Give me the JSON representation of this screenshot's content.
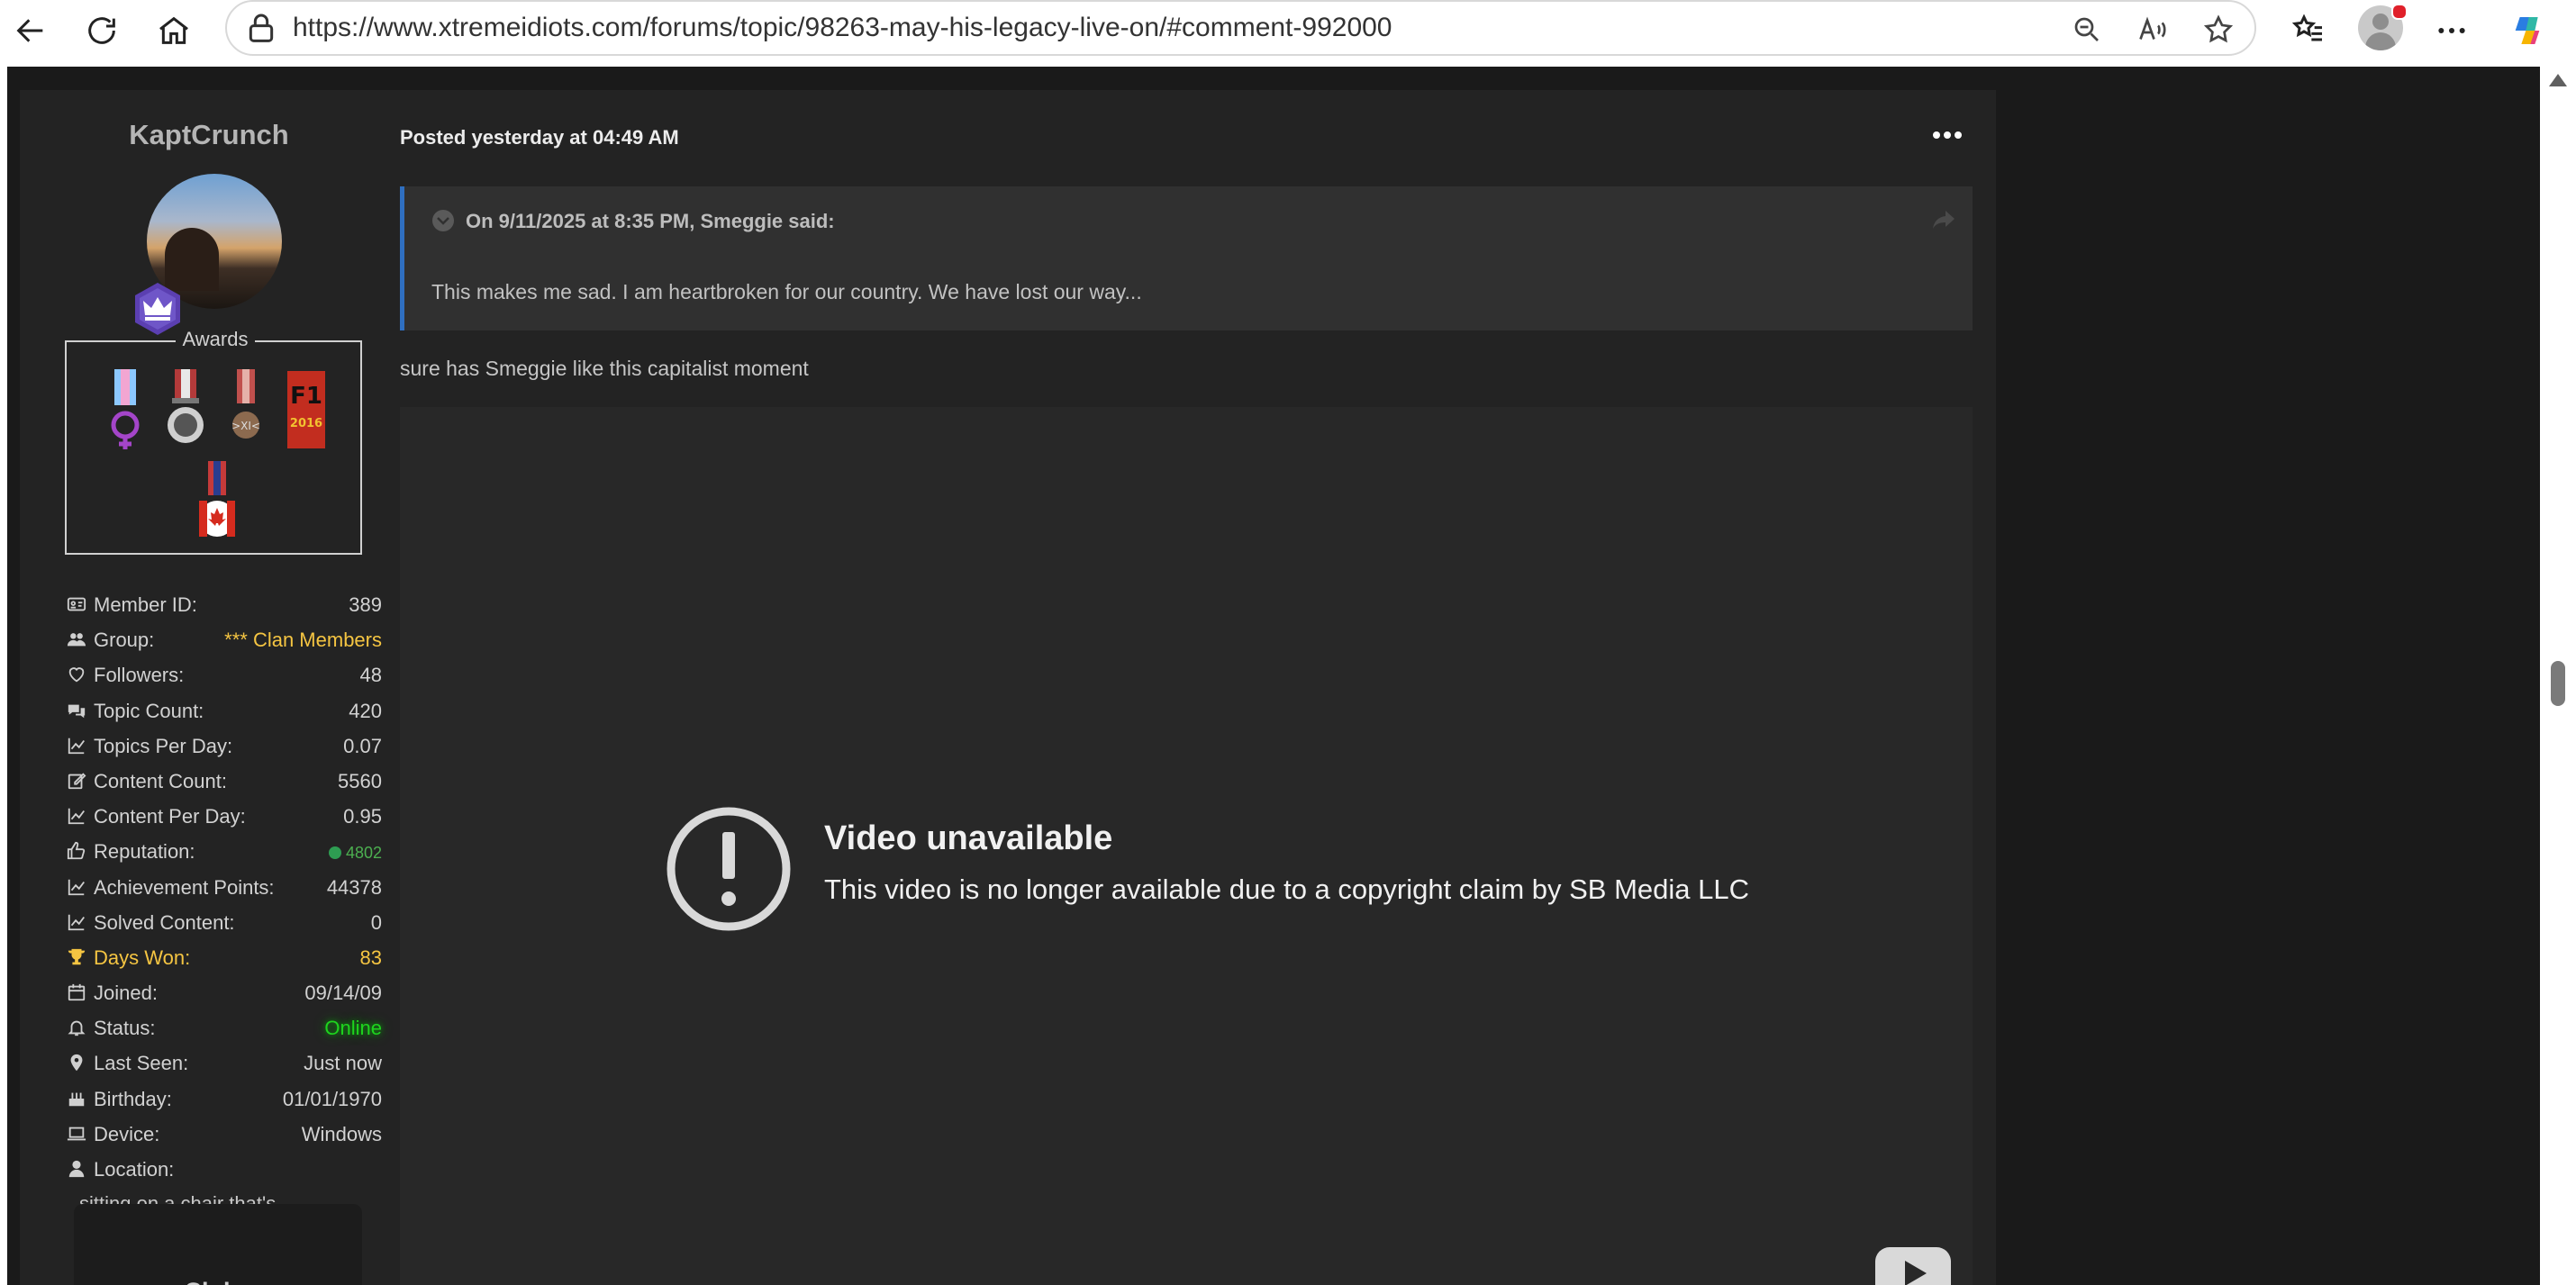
{
  "browser": {
    "url": "https://www.xtremeidiots.com/forums/topic/98263-may-his-legacy-live-on/#comment-992000"
  },
  "author": {
    "name": "KaptCrunch",
    "awards_title": "Awards",
    "stats": [
      {
        "icon": "id-card-icon",
        "label": "Member ID:",
        "value": "389"
      },
      {
        "icon": "users-icon",
        "label": "Group:",
        "value": "*** Clan Members"
      },
      {
        "icon": "heart-icon",
        "label": "Followers:",
        "value": "48"
      },
      {
        "icon": "comments-icon",
        "label": "Topic Count:",
        "value": "420"
      },
      {
        "icon": "line-chart-icon",
        "label": "Topics Per Day:",
        "value": "0.07"
      },
      {
        "icon": "edit-icon",
        "label": "Content Count:",
        "value": "5560"
      },
      {
        "icon": "line-chart-icon",
        "label": "Content Per Day:",
        "value": "0.95"
      },
      {
        "icon": "thumbs-up-icon",
        "label": "Reputation:",
        "value": "4802"
      },
      {
        "icon": "line-chart-icon",
        "label": "Achievement Points:",
        "value": "44378"
      },
      {
        "icon": "line-chart-icon",
        "label": "Solved Content:",
        "value": "0"
      },
      {
        "icon": "trophy-icon",
        "label": "Days Won:",
        "value": "83"
      },
      {
        "icon": "calendar-icon",
        "label": "Joined:",
        "value": "09/14/09"
      },
      {
        "icon": "bell-icon",
        "label": "Status:",
        "value": "Online"
      },
      {
        "icon": "map-marker-icon",
        "label": "Last Seen:",
        "value": "Just now"
      },
      {
        "icon": "birthday-cake-icon",
        "label": "Birthday:",
        "value": "01/01/1970"
      },
      {
        "icon": "laptop-icon",
        "label": "Device:",
        "value": "Windows"
      },
      {
        "icon": "user-icon",
        "label": "Location:",
        "value": ""
      }
    ],
    "location_value": "sitting on a chair that's",
    "clubs_label": "Clubs"
  },
  "post": {
    "posted": "Posted yesterday at 04:49 AM",
    "quote": {
      "cite": "On 9/11/2025 at 8:35 PM, Smeggie said:",
      "body": "This makes me sad.  I am heartbroken for our country.  We have lost our way..."
    },
    "text": "sure has Smeggie  like this capitalist  moment",
    "video": {
      "title": "Video unavailable",
      "message": "This video is no longer available due to a copyright claim by SB Media LLC"
    }
  },
  "colors": {
    "page_bg": "#1a1a1a",
    "post_bg": "#232323",
    "quote_bg": "#303030",
    "quote_border": "#2f6fc0",
    "group_gold": "#f5c542",
    "reputation_green": "#2e9d52",
    "online_green": "#1ed41e"
  }
}
